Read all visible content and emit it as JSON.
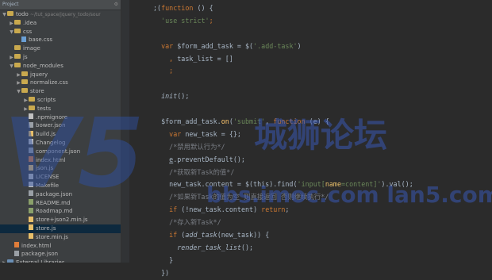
{
  "project_panel": {
    "title": "Project",
    "tree": [
      {
        "label": "todo",
        "note": "~/tut_space/jquery_todo/sour",
        "indent": 0,
        "arrow": "▼",
        "icon": "folder"
      },
      {
        "label": ".idea",
        "indent": 1,
        "arrow": "▶",
        "icon": "folder"
      },
      {
        "label": "css",
        "indent": 1,
        "arrow": "▼",
        "icon": "folder"
      },
      {
        "label": "base.css",
        "indent": 2,
        "arrow": "",
        "icon": "file-css"
      },
      {
        "label": "image",
        "indent": 1,
        "arrow": "",
        "icon": "folder"
      },
      {
        "label": "js",
        "indent": 1,
        "arrow": "▶",
        "icon": "folder"
      },
      {
        "label": "node_modules",
        "indent": 1,
        "arrow": "▼",
        "icon": "folder"
      },
      {
        "label": "jquery",
        "indent": 2,
        "arrow": "▶",
        "icon": "folder"
      },
      {
        "label": "normalize.css",
        "indent": 2,
        "arrow": "▶",
        "icon": "folder"
      },
      {
        "label": "store",
        "indent": 2,
        "arrow": "▼",
        "icon": "folder"
      },
      {
        "label": "scripts",
        "indent": 3,
        "arrow": "▶",
        "icon": "folder"
      },
      {
        "label": "tests",
        "indent": 3,
        "arrow": "▶",
        "icon": "folder"
      },
      {
        "label": ".npmignore",
        "indent": 3,
        "arrow": "",
        "icon": "file-txt"
      },
      {
        "label": "bower.json",
        "indent": 3,
        "arrow": "",
        "icon": "file-json"
      },
      {
        "label": "build.js",
        "indent": 3,
        "arrow": "",
        "icon": "file-js"
      },
      {
        "label": "Changelog",
        "indent": 3,
        "arrow": "",
        "icon": "file-txt"
      },
      {
        "label": "component.json",
        "indent": 3,
        "arrow": "",
        "icon": "file-json"
      },
      {
        "label": "index.html",
        "indent": 3,
        "arrow": "",
        "icon": "file-html"
      },
      {
        "label": "json.js",
        "indent": 3,
        "arrow": "",
        "icon": "file-js"
      },
      {
        "label": "LICENSE",
        "indent": 3,
        "arrow": "",
        "icon": "file-txt"
      },
      {
        "label": "Makefile",
        "indent": 3,
        "arrow": "",
        "icon": "file-txt"
      },
      {
        "label": "package.json",
        "indent": 3,
        "arrow": "",
        "icon": "file-json"
      },
      {
        "label": "README.md",
        "indent": 3,
        "arrow": "",
        "icon": "file-md"
      },
      {
        "label": "Roadmap.md",
        "indent": 3,
        "arrow": "",
        "icon": "file-md"
      },
      {
        "label": "store+json2.min.js",
        "indent": 3,
        "arrow": "",
        "icon": "file-js"
      },
      {
        "label": "store.js",
        "indent": 3,
        "arrow": "",
        "icon": "file-js",
        "selected": true
      },
      {
        "label": "store.min.js",
        "indent": 3,
        "arrow": "",
        "icon": "file-js"
      },
      {
        "label": "index.html",
        "indent": 1,
        "arrow": "",
        "icon": "file-html"
      },
      {
        "label": "package.json",
        "indent": 1,
        "arrow": "",
        "icon": "file-json"
      },
      {
        "label": "External Libraries",
        "indent": 0,
        "arrow": "▶",
        "icon": "folder-blue"
      }
    ]
  },
  "editor": {
    "lines": [
      [
        {
          "t": ";(",
          "c": ""
        },
        {
          "t": "function",
          "c": "kw"
        },
        {
          "t": " () {",
          "c": ""
        }
      ],
      [
        {
          "t": "  ",
          "c": ""
        },
        {
          "t": "'use strict'",
          "c": "str"
        },
        {
          "t": ";",
          "c": "kw"
        }
      ],
      [],
      [
        {
          "t": "  ",
          "c": ""
        },
        {
          "t": "var",
          "c": "kw"
        },
        {
          "t": " $form_add_task = $(",
          "c": ""
        },
        {
          "t": "'.add-task'",
          "c": "str"
        },
        {
          "t": ")",
          "c": ""
        }
      ],
      [
        {
          "t": "    ",
          "c": ""
        },
        {
          "t": ",",
          "c": "kw"
        },
        {
          "t": " task_list = []",
          "c": ""
        }
      ],
      [
        {
          "t": "    ",
          "c": ""
        },
        {
          "t": ";",
          "c": "kw"
        }
      ],
      [],
      [
        {
          "t": "  ",
          "c": ""
        },
        {
          "t": "init",
          "c": "it"
        },
        {
          "t": "();",
          "c": ""
        }
      ],
      [],
      [
        {
          "t": "  $form_add_task.",
          "c": ""
        },
        {
          "t": "on",
          "c": "fn"
        },
        {
          "t": "(",
          "c": ""
        },
        {
          "t": "'submit'",
          "c": "str"
        },
        {
          "t": ", ",
          "c": ""
        },
        {
          "t": "function",
          "c": "kw"
        },
        {
          "t": " (e) {",
          "c": ""
        }
      ],
      [
        {
          "t": "    ",
          "c": ""
        },
        {
          "t": "var",
          "c": "kw"
        },
        {
          "t": " new_task = {};",
          "c": ""
        }
      ],
      [
        {
          "t": "    ",
          "c": ""
        },
        {
          "t": "/*禁用默认行为*/",
          "c": "cm"
        }
      ],
      [
        {
          "t": "    ",
          "c": ""
        },
        {
          "t": "e",
          "c": "ul"
        },
        {
          "t": ".preventDefault();",
          "c": ""
        }
      ],
      [
        {
          "t": "    ",
          "c": ""
        },
        {
          "t": "/*获取新Task的值*/",
          "c": "cm"
        }
      ],
      [
        {
          "t": "    new_task.content = $(this).find(",
          "c": ""
        },
        {
          "t": "'input[",
          "c": "str"
        },
        {
          "t": "name",
          "c": "tag"
        },
        {
          "t": "=content]'",
          "c": "str"
        },
        {
          "t": ").val();",
          "c": ""
        }
      ],
      [
        {
          "t": "    ",
          "c": ""
        },
        {
          "t": "/*如果新Task的值为空 则直接返回 否则继续执行*/",
          "c": "cm"
        }
      ],
      [
        {
          "t": "    ",
          "c": ""
        },
        {
          "t": "if",
          "c": "kw"
        },
        {
          "t": " (!new_task.content) ",
          "c": ""
        },
        {
          "t": "return",
          "c": "kw"
        },
        {
          "t": ";",
          "c": ""
        }
      ],
      [
        {
          "t": "    ",
          "c": ""
        },
        {
          "t": "/*存入新Task*/",
          "c": "cm"
        }
      ],
      [
        {
          "t": "    ",
          "c": ""
        },
        {
          "t": "if",
          "c": "kw"
        },
        {
          "t": " (",
          "c": ""
        },
        {
          "t": "add_task",
          "c": "it"
        },
        {
          "t": "(new_task)) {",
          "c": ""
        }
      ],
      [
        {
          "t": "      ",
          "c": ""
        },
        {
          "t": "render_task_list",
          "c": "it"
        },
        {
          "t": "();",
          "c": ""
        }
      ],
      [
        {
          "t": "    }",
          "c": ""
        }
      ],
      [
        {
          "t": "  })",
          "c": ""
        }
      ]
    ]
  },
  "watermark": {
    "logo": "V5",
    "cn_text": "城狮论坛",
    "url_text": "bbs.imoc.com  lan5.com"
  }
}
